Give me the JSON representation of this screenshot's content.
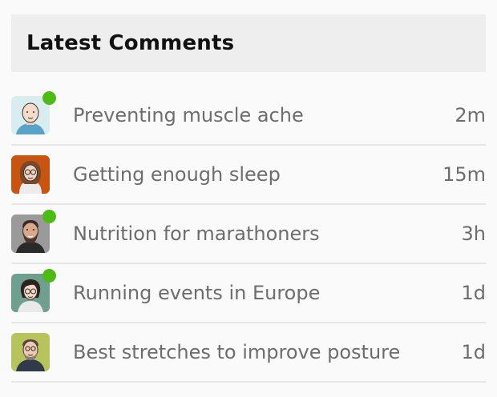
{
  "widget": {
    "title": "Latest Comments"
  },
  "colors": {
    "online": "#4cbc12",
    "header_bg": "#eeeeee",
    "text": "#6d6d6d"
  },
  "comments": [
    {
      "title": "Preventing muscle ache",
      "time": "2m",
      "online": true,
      "avatar_icon": "bald-man-avatar"
    },
    {
      "title": "Getting enough sleep",
      "time": "15m",
      "online": false,
      "avatar_icon": "woman-glasses-avatar"
    },
    {
      "title": "Nutrition for marathoners",
      "time": "3h",
      "online": true,
      "avatar_icon": "bearded-man-avatar"
    },
    {
      "title": "Running events in Europe",
      "time": "1d",
      "online": true,
      "avatar_icon": "woman-dark-hair-avatar"
    },
    {
      "title": "Best stretches to improve posture",
      "time": "1d",
      "online": false,
      "avatar_icon": "man-hoodie-avatar"
    }
  ]
}
